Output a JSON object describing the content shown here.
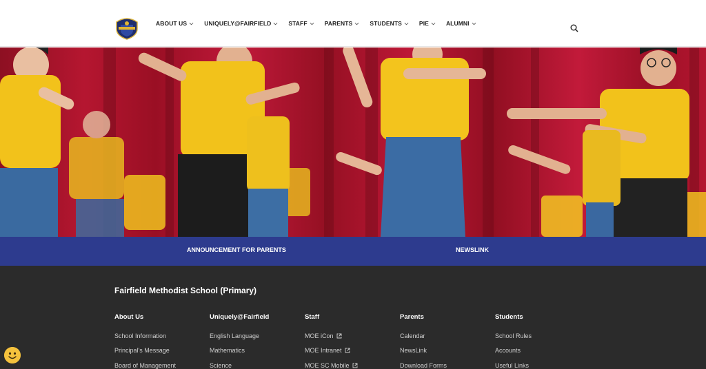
{
  "nav": {
    "items": [
      {
        "label": "ABOUT US"
      },
      {
        "label": "UNIQUELY@FAIRFIELD"
      },
      {
        "label": "STAFF"
      },
      {
        "label": "PARENTS"
      },
      {
        "label": "STUDENTS"
      },
      {
        "label": "PIE"
      },
      {
        "label": "ALUMNI"
      }
    ],
    "search_icon": "search-icon"
  },
  "hero": {
    "image_description_icon": "students-dancing-photo"
  },
  "quicklinks": {
    "announcement": "ANNOUNCEMENT FOR PARENTS",
    "newslink": "NEWSLINK"
  },
  "footer": {
    "school_name": "Fairfield Methodist School (Primary)",
    "columns": [
      {
        "title": "About Us",
        "links": [
          "School Information",
          "Principal's Message",
          "Board of Management"
        ]
      },
      {
        "title": "Uniquely@Fairfield",
        "links": [
          "English Language",
          "Mathematics",
          "Science"
        ]
      },
      {
        "title": "Staff",
        "links": [
          "MOE iCon",
          "MOE Intranet",
          "MOE SC Mobile"
        ]
      },
      {
        "title": "Parents",
        "links": [
          "Calendar",
          "NewsLink",
          "Download Forms"
        ]
      },
      {
        "title": "Students",
        "links": [
          "School Rules",
          "Accounts",
          "Useful Links"
        ]
      }
    ]
  },
  "colors": {
    "brand_blue": "#2d3b8e",
    "footer_bg": "#2b2b2b",
    "uniform_yellow": "#f2c21b",
    "curtain_red": "#b3152f"
  }
}
